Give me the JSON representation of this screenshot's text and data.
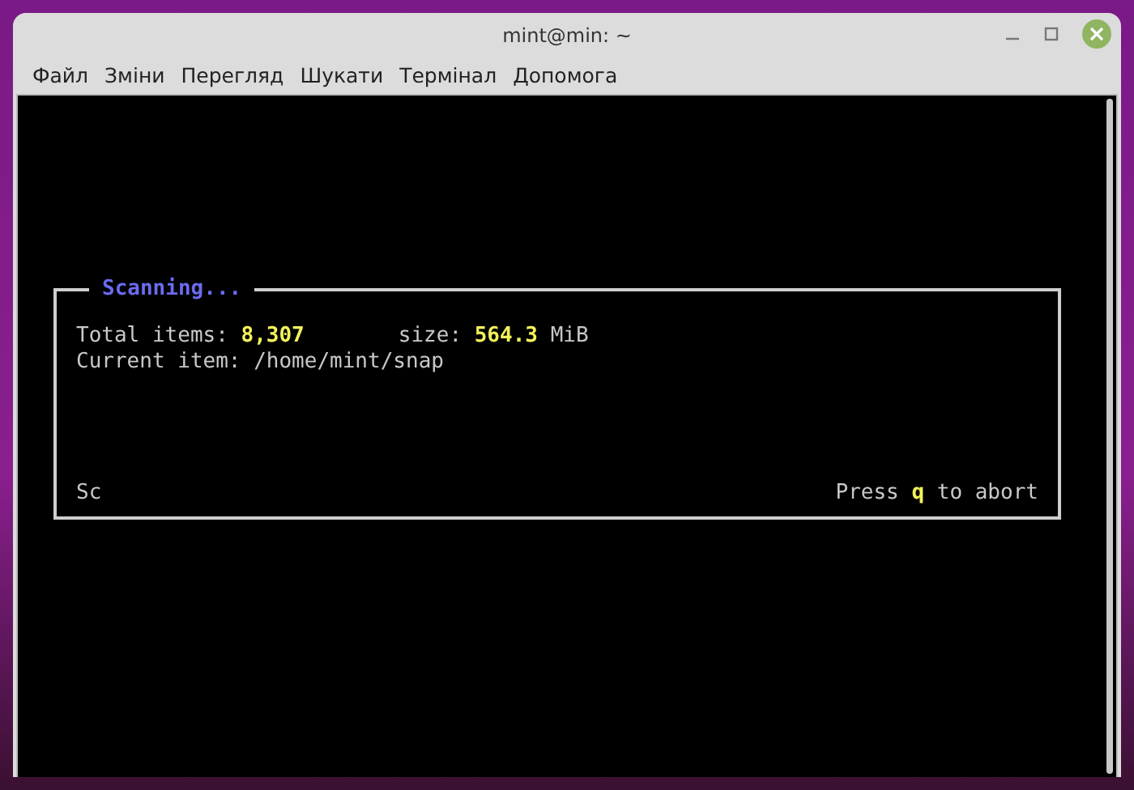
{
  "window": {
    "title": "mint@min: ~"
  },
  "menu": [
    "Файл",
    "Зміни",
    "Перегляд",
    "Шукати",
    "Термінал",
    "Допомога"
  ],
  "dialog": {
    "title": "Scanning...",
    "rows": [
      {
        "left": "Total items: **8,307**",
        "right": "size: **564.3** MiB"
      },
      {
        "left": "Current item: /home/mint/snap"
      }
    ],
    "footer_left": "Sc",
    "footer_right": "Press **q** to abort"
  }
}
